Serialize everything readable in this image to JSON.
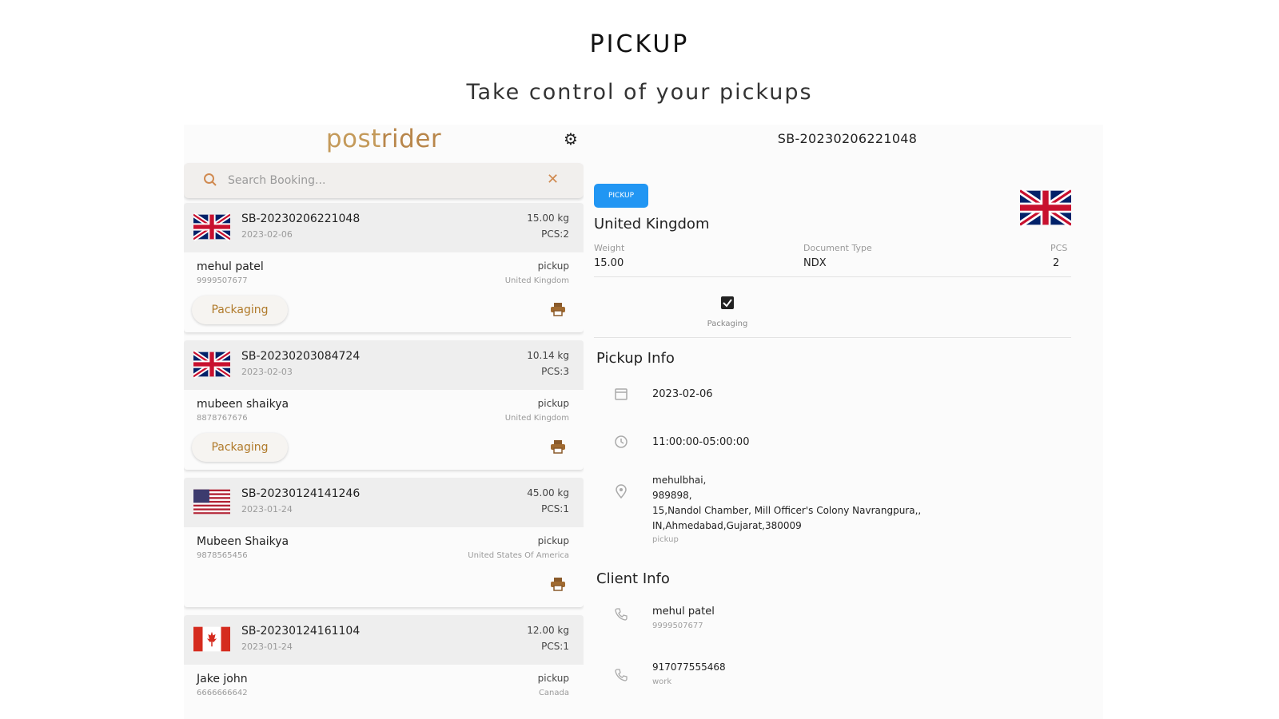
{
  "headline": "PICKUP",
  "subheadline": "Take control of your pickups",
  "app": {
    "logo_prefix": "p",
    "logo_o": "o",
    "logo_mid": "st",
    "logo_suffix": "rider",
    "search_placeholder": "Search Booking...",
    "bookings": [
      {
        "id": "SB-20230206221048",
        "date": "2023-02-06",
        "weight": "15.00 kg",
        "pcs": "PCS:2",
        "name": "mehul patel",
        "phone": "9999507677",
        "type": "pickup",
        "country": "United Kingdom",
        "status": "Packaging",
        "flag": "uk"
      },
      {
        "id": "SB-20230203084724",
        "date": "2023-02-03",
        "weight": "10.14 kg",
        "pcs": "PCS:3",
        "name": "mubeen shaikya",
        "phone": "8878767676",
        "type": "pickup",
        "country": "United Kingdom",
        "status": "Packaging",
        "flag": "uk"
      },
      {
        "id": "SB-20230124141246",
        "date": "2023-01-24",
        "weight": "45.00 kg",
        "pcs": "PCS:1",
        "name": "Mubeen Shaikya",
        "phone": "9878565456",
        "type": "pickup",
        "country": "United States Of America",
        "status": "",
        "flag": "us"
      },
      {
        "id": "SB-20230124161104",
        "date": "2023-01-24",
        "weight": "12.00 kg",
        "pcs": "PCS:1",
        "name": "Jake john",
        "phone": "6666666642",
        "type": "pickup",
        "country": "Canada",
        "status": "",
        "flag": "ca"
      }
    ],
    "detail": {
      "title": "SB-20230206221048",
      "badge": "PICKUP",
      "country": "United Kingdom",
      "weight_label": "Weight",
      "weight_value": "15.00",
      "doc_label": "Document Type",
      "doc_value": "NDX",
      "pcs_label": "PCS",
      "pcs_value": "2",
      "tab_label": "Packaging",
      "pickup_info_title": "Pickup Info",
      "pickup_date": "2023-02-06",
      "pickup_time": "11:00:00-05:00:00",
      "address_lines": [
        "mehulbhai,",
        "989898,",
        "15,Nandol Chamber, Mill Officer's Colony Navrangpura,,",
        "IN,Ahmedabad,Gujarat,380009"
      ],
      "address_type": "pickup",
      "client_info_title": "Client Info",
      "client_name": "mehul patel",
      "client_phone": "9999507677",
      "client_alt_phone": "917077555468",
      "client_alt_label": "work"
    }
  },
  "colors": {
    "accent": "#c49a5a",
    "badge": "#2196f3",
    "status_text": "#b07a2a"
  }
}
